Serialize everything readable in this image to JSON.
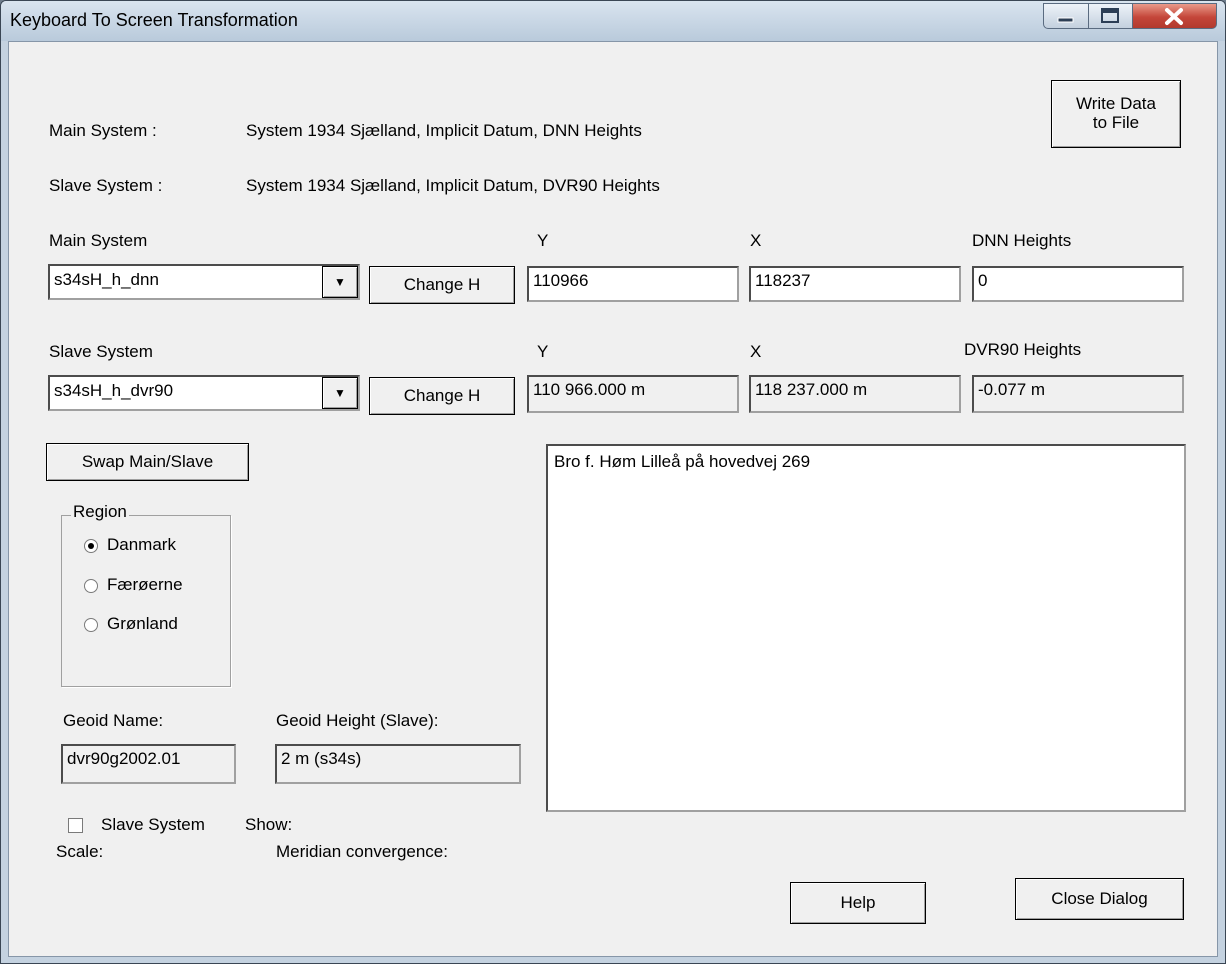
{
  "window": {
    "title": "Keyboard To Screen Transformation",
    "controls": {
      "minimize": "–",
      "maximize": "□",
      "close": "X"
    }
  },
  "header": {
    "write_data_label": "Write Data\nto File",
    "main_system_label": "Main System :",
    "main_system_desc": "System 1934 Sjælland,  Implicit Datum, DNN Heights",
    "slave_system_label": "Slave System :",
    "slave_system_desc": "System 1934 Sjælland,  Implicit Datum, DVR90 Heights"
  },
  "main": {
    "label": "Main System",
    "combo_value": "s34sH_h_dnn",
    "change_label": "Change H",
    "y_label": "Y",
    "x_label": "X",
    "h_label": "DNN Heights",
    "y_value": "110966",
    "x_value": "118237",
    "h_value": "0"
  },
  "slave": {
    "label": "Slave System",
    "combo_value": "s34sH_h_dvr90",
    "change_label": "Change H",
    "y_label": "Y",
    "x_label": "X",
    "h_label": "DVR90 Heights",
    "y_value": "110 966.000 m",
    "x_value": "118 237.000 m",
    "h_value": "-0.077 m"
  },
  "swap_label": "Swap Main/Slave",
  "region": {
    "legend": "Region",
    "options": [
      "Danmark",
      "Færøerne",
      "Grønland"
    ],
    "selected": "Danmark"
  },
  "geoid": {
    "name_label": "Geoid Name:",
    "name_value": "dvr90g2002.01",
    "height_label": "Geoid Height (Slave):",
    "height_value": "2 m  (s34s)"
  },
  "show": {
    "checkbox_label": "Slave System",
    "show_label": "Show:",
    "scale_label": "Scale:",
    "meridian_label": "Meridian convergence:"
  },
  "notes": "Bro f. Høm Lilleå på hovedvej 269",
  "footer": {
    "help_label": "Help",
    "close_label": "Close Dialog"
  }
}
